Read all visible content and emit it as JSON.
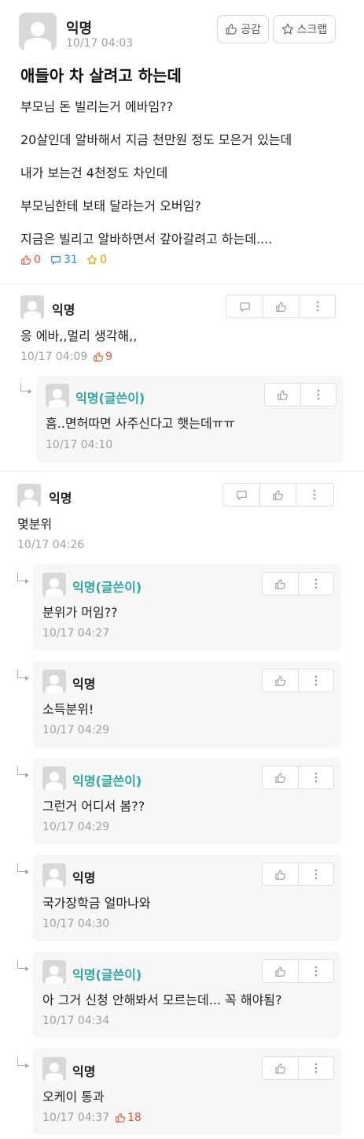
{
  "post": {
    "author": "익명",
    "time": "10/17 04:03",
    "like_button_label": "공감",
    "scrap_button_label": "스크랩",
    "title": "애들아 차 살려고 하는데",
    "lines": [
      "부모님 돈 빌리는거 에바임??",
      "20살인데 알바해서 지금 천만원 정도 모은거 있는데",
      "내가 보는건 4천정도 차인데",
      "부모님한테 보태 달라는거 오버임?",
      "지금은 빌리고 알바하면서 갚아갈려고 하는데...."
    ],
    "stats": {
      "likes": "0",
      "comments": "31",
      "scraps": "0"
    }
  },
  "comments": [
    {
      "author": "익명",
      "text": "응 에바,,멀리 생각해,,",
      "time": "10/17 04:09",
      "likes": "9"
    },
    {
      "author": "익명(글쓴이)",
      "text": "흠..면허따면 사주신다고 햇는데ㅠㅠ",
      "time": "10/17 04:10"
    },
    {
      "author": "익명",
      "text": "몇분위",
      "time": "10/17 04:26"
    },
    {
      "author": "익명(글쓴이)",
      "text": "분위가 머임??",
      "time": "10/17 04:27"
    },
    {
      "author": "익명",
      "text": "소득분위!",
      "time": "10/17 04:29"
    },
    {
      "author": "익명(글쓴이)",
      "text": "그런거 어디서 봄??",
      "time": "10/17 04:29"
    },
    {
      "author": "익명",
      "text": "국가장학금 얼마나와",
      "time": "10/17 04:30"
    },
    {
      "author": "익명(글쓴이)",
      "text": "아 그거 신청 안해봐서 모르는데... 꼭 해야됨?",
      "time": "10/17 04:34"
    },
    {
      "author": "익명",
      "text": "오케이 통과",
      "time": "10/17 04:37",
      "likes": "18"
    }
  ],
  "colors": {
    "op_name": "#2ea8a0",
    "like": "#e05a3a",
    "comment": "#2a8fd0",
    "scrap": "#d9a400",
    "time": "#a0a0a0"
  },
  "icons": {
    "like": "thumbs-up-icon",
    "comment": "speech-bubble-icon",
    "scrap": "star-icon",
    "more": "vertical-dots-icon",
    "reply": "reply-arrow-icon"
  }
}
